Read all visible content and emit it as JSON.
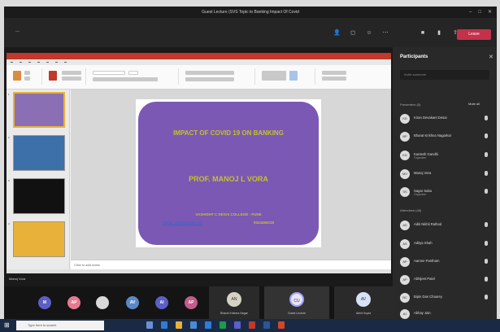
{
  "window": {
    "title": "Guest Lecture (SVS Topic to Banking Impact Of Covid"
  },
  "meeting": {
    "timer": "—",
    "leave_label": "Leave",
    "toolbar_icons": [
      "people-icon",
      "chat-icon",
      "more-icon",
      "camera-icon",
      "mic-icon",
      "share-icon"
    ]
  },
  "presentation": {
    "slide_title": "IMPACT OF COVID 19 ON BANKING",
    "presenter_name": "PROF. MANOJ L VORA",
    "college": "VASHISHT C DESAI COLLEGE - PUNE",
    "email": "manoj_vora@gmail.com",
    "phone": "9324456218",
    "notes_placeholder": "Click to add notes",
    "slide_numbers": [
      "1",
      "2",
      "3",
      "4"
    ]
  },
  "stage": {
    "presenter_label": "Manoj Vora"
  },
  "bottom_participants": [
    {
      "initials": "M",
      "color": "#5b5fc7"
    },
    {
      "initials": "AP",
      "color": "#e87a8f"
    },
    {
      "initials": "",
      "color": "#d9d9d9"
    },
    {
      "initials": "AV",
      "color": "#5b88c7"
    },
    {
      "initials": "AI",
      "color": "#5b5fc7"
    },
    {
      "initials": "AP",
      "color": "#c45c8a"
    }
  ],
  "bottom_tiles": [
    {
      "initials": "AN",
      "name": "Bharat Krishna Nagar",
      "color": "#d7d2c6"
    },
    {
      "initials": "CU",
      "name": "Guest Lecture",
      "color": "#e9e4f6"
    },
    {
      "initials": "AV",
      "name": "Akhil Gupta",
      "color": "#d7e2f6"
    }
  ],
  "participants_panel": {
    "title": "Participants",
    "search_placeholder": "Invite someone",
    "presenters_label": "Presenters (5)",
    "mute_all_label": "Mute all",
    "attendees_label": "Attendees (48)",
    "presenters": [
      {
        "initials": "KD",
        "name": "Kiran Devakant Desai",
        "sub": ""
      },
      {
        "initials": "BP",
        "name": "Bharat Krishna Nagarkar",
        "sub": ""
      },
      {
        "initials": "KG",
        "name": "Kantesh Gandhi",
        "sub": "Organizer"
      },
      {
        "initials": "MV",
        "name": "Manoj Vora",
        "sub": ""
      },
      {
        "initials": "SS",
        "name": "Sagar Sabu",
        "sub": "Organizer"
      }
    ],
    "attendees": [
      {
        "initials": "AS",
        "name": "Aditi Nikhil Rathod",
        "sub": ""
      },
      {
        "initials": "AS",
        "name": "Aditya Shah",
        "sub": ""
      },
      {
        "initials": "AP",
        "name": "Aarone Pantham",
        "sub": ""
      },
      {
        "initials": "AP",
        "name": "Abhijeet Patel",
        "sub": ""
      },
      {
        "initials": "BC",
        "name": "Bipin Das Chaurey",
        "sub": ""
      },
      {
        "initials": "AJ",
        "name": "Abhay Jain",
        "sub": ""
      }
    ]
  },
  "taskbar": {
    "search_placeholder": "Type here to search",
    "time": "",
    "date": ""
  }
}
